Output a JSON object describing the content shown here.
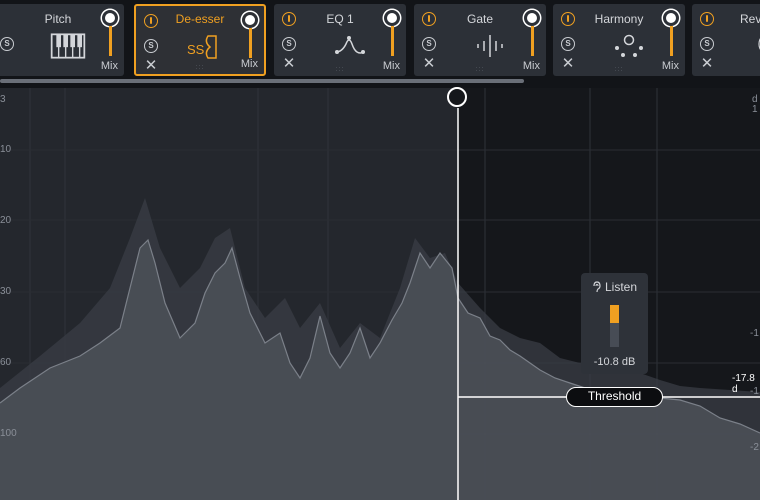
{
  "modules": [
    {
      "title": "Pitch",
      "icon": "piano-keys-icon",
      "mix_label": "Mix",
      "selected": false
    },
    {
      "title": "De-esser",
      "icon": "de-esser-icon",
      "icon_text": "SS",
      "mix_label": "Mix",
      "selected": true
    },
    {
      "title": "EQ 1",
      "icon": "eq-curve-icon",
      "mix_label": "Mix",
      "selected": false
    },
    {
      "title": "Gate",
      "icon": "gate-icon",
      "mix_label": "Mix",
      "selected": false
    },
    {
      "title": "Harmony",
      "icon": "harmony-icon",
      "mix_label": "Mix",
      "selected": false
    },
    {
      "title": "Rev",
      "icon": "reverb-icon",
      "mix_label": "",
      "selected": false
    }
  ],
  "solo_label": "S",
  "close_symbol": "✕",
  "grip_symbol": ":::",
  "y_axis_left": [
    "3",
    "10",
    "20",
    "30",
    "60",
    "100"
  ],
  "y_axis_right": [
    "d",
    "1",
    "-1",
    "-1",
    "-2"
  ],
  "listen": {
    "label": "Listen",
    "value": "-10.8 dB",
    "level": 0.42
  },
  "threshold": {
    "label": "Threshold",
    "value": "-17.8 d"
  },
  "colors": {
    "accent": "#f0a021",
    "module_bg": "#2c3037",
    "display_bg": "#1c1f25"
  }
}
